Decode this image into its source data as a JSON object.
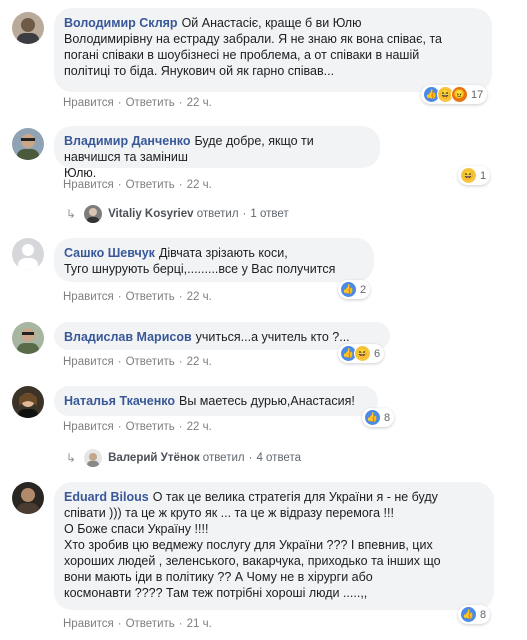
{
  "comments": [
    {
      "author": "Володимир Скляр",
      "text": "Ой Анастасіє, краще б ви Юлю\nВолодимирівну на естраду забрали. Я не знаю як вона співає, та\nпогані співаки в шоубізнесі не проблема, а от співаки в нашій\nполітиці то біда. Янукович ой як гарно співав...",
      "like": "Нравится",
      "reply": "Ответить",
      "time": "22 ч.",
      "reaction_count": "17"
    },
    {
      "author": "Владимир Данченко",
      "text": "Буде добре, якщо ти навчишся та заміниш\nЮлю.",
      "like": "Нравится",
      "reply": "Ответить",
      "time": "22 ч.",
      "reaction_count": "1",
      "reply_thread": {
        "name": "Vitaliy Kosyriev",
        "verb": "ответил",
        "count": "1 ответ"
      }
    },
    {
      "author": "Сашко Шевчук",
      "text": "Дівчата зрізають коси,\nТуго шнурують берці,.........все у Вас получится",
      "like": "Нравится",
      "reply": "Ответить",
      "time": "22 ч.",
      "reaction_count": "2"
    },
    {
      "author": "Владислав Марисов",
      "text": "учиться...а учитель кто ?...",
      "like": "Нравится",
      "reply": "Ответить",
      "time": "22 ч.",
      "reaction_count": "6"
    },
    {
      "author": "Наталья Ткаченко",
      "text": "Вы маетесь дурью,Анастасия!",
      "like": "Нравится",
      "reply": "Ответить",
      "time": "22 ч.",
      "reaction_count": "8",
      "reply_thread": {
        "name": "Валерий Утёнок",
        "verb": "ответил",
        "count": "4 ответа"
      }
    },
    {
      "author": "Eduard Bilous",
      "text": "О так це велика стратегія для України я - не буду\nспівати ))) та це ж круто як ... та це ж відразу перемога !!!\nО Боже спаси Україну !!!!\nХто зробив цю ведмежу послугу для України ??? І впевнив, цих\nхороших людей , зеленського, вакарчука, приходько та інших що\nвони мають іди в політику ?? А Чому не в хірурги або\nкосмонавти ???? Там теж потрібні хороші люди .....,,",
      "like": "Нравится",
      "reply": "Ответить",
      "time": "21 ч.",
      "reaction_count": "8"
    }
  ],
  "colors": {
    "link": "#385898",
    "bubble": "#f2f3f5",
    "like": "#4c8ae8",
    "haha": "#f7c440",
    "angry": "#e9710f"
  },
  "icons": [
    "like-icon",
    "haha-icon",
    "angry-icon",
    "reply-arrow-icon"
  ]
}
